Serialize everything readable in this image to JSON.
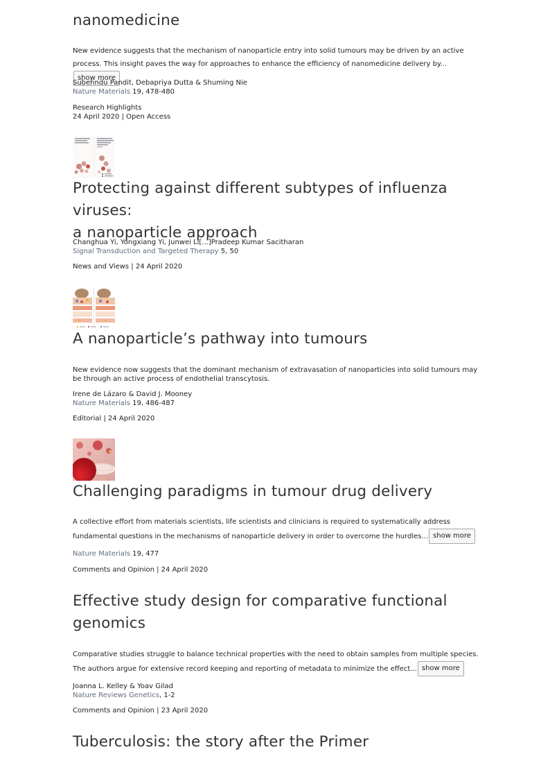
{
  "articles": [
    {
      "title": "nanomedicine",
      "summary": "New evidence suggests that the mechanism of nanoparticle entry into solid tumours may be driven by an active process. This insight paves the way for approaches to enhance the efficiency of nanomedicine delivery by...",
      "show_more": "show more",
      "authors": "Subehndu Pandit, Debapriya Dutta & Shuming Nie",
      "journal": "Nature Materials",
      "citation": " 19, 478-480",
      "type": "Research Highlights",
      "date_line": "24 April 2020 | Open Access"
    },
    {
      "title_line1": "Protecting against different subtypes of influenza viruses:",
      "title_line2": "a nanoparticle approach",
      "authors": "Changhua Yi, Yongxiang Yi, Junwei Li[...]Pradeep Kumar Sacitharan",
      "journal": "Signal Transduction and Targeted Therapy",
      "citation": " 5, 50",
      "type_date": "News and Views | 24 April 2020"
    },
    {
      "title": "A nanoparticle’s pathway into tumours",
      "summary": "New evidence now suggests that the dominant mechanism of extravasation of nanoparticles into solid tumours may be through an active process of endothelial transcytosis.",
      "authors": "Irene de Lázaro & David J. Mooney",
      "journal": "Nature Materials",
      "citation": " 19, 486-487",
      "type_date": "Editorial | 24 April 2020"
    },
    {
      "title": "Challenging paradigms in tumour drug delivery",
      "summary": "A collective effort from materials scientists, life scientists and clinicians is required to systematically address fundamental questions in the mechanisms of nanoparticle delivery in order to overcome the hurdles...",
      "show_more": "show more",
      "journal": "Nature Materials",
      "citation": " 19, 477",
      "type_date": "Comments and Opinion | 24 April 2020"
    },
    {
      "title_line1": "Effective study design for comparative functional",
      "title_line2": "genomics",
      "summary": "Comparative studies struggle to balance technical properties with the need to obtain samples from multiple species. The authors argue for extensive record keeping and reporting of metadata to minimize the effect...",
      "show_more": "show more",
      "authors": "Joanna L. Kelley & Yoav Gilad",
      "journal": "Nature Reviews Genetics",
      "citation": ", 1-2",
      "type_date": "Comments and Opinion | 23 April 2020"
    },
    {
      "title": "Tuberculosis: the story after the Primer"
    }
  ],
  "thumbnails": [
    {
      "name": "figure-thumbnail-influenza",
      "accent": "#c0574f"
    },
    {
      "name": "figure-thumbnail-pathway",
      "accent": "#d08a4a"
    },
    {
      "name": "figure-thumbnail-paradigms",
      "accent": "#b3121e"
    }
  ]
}
